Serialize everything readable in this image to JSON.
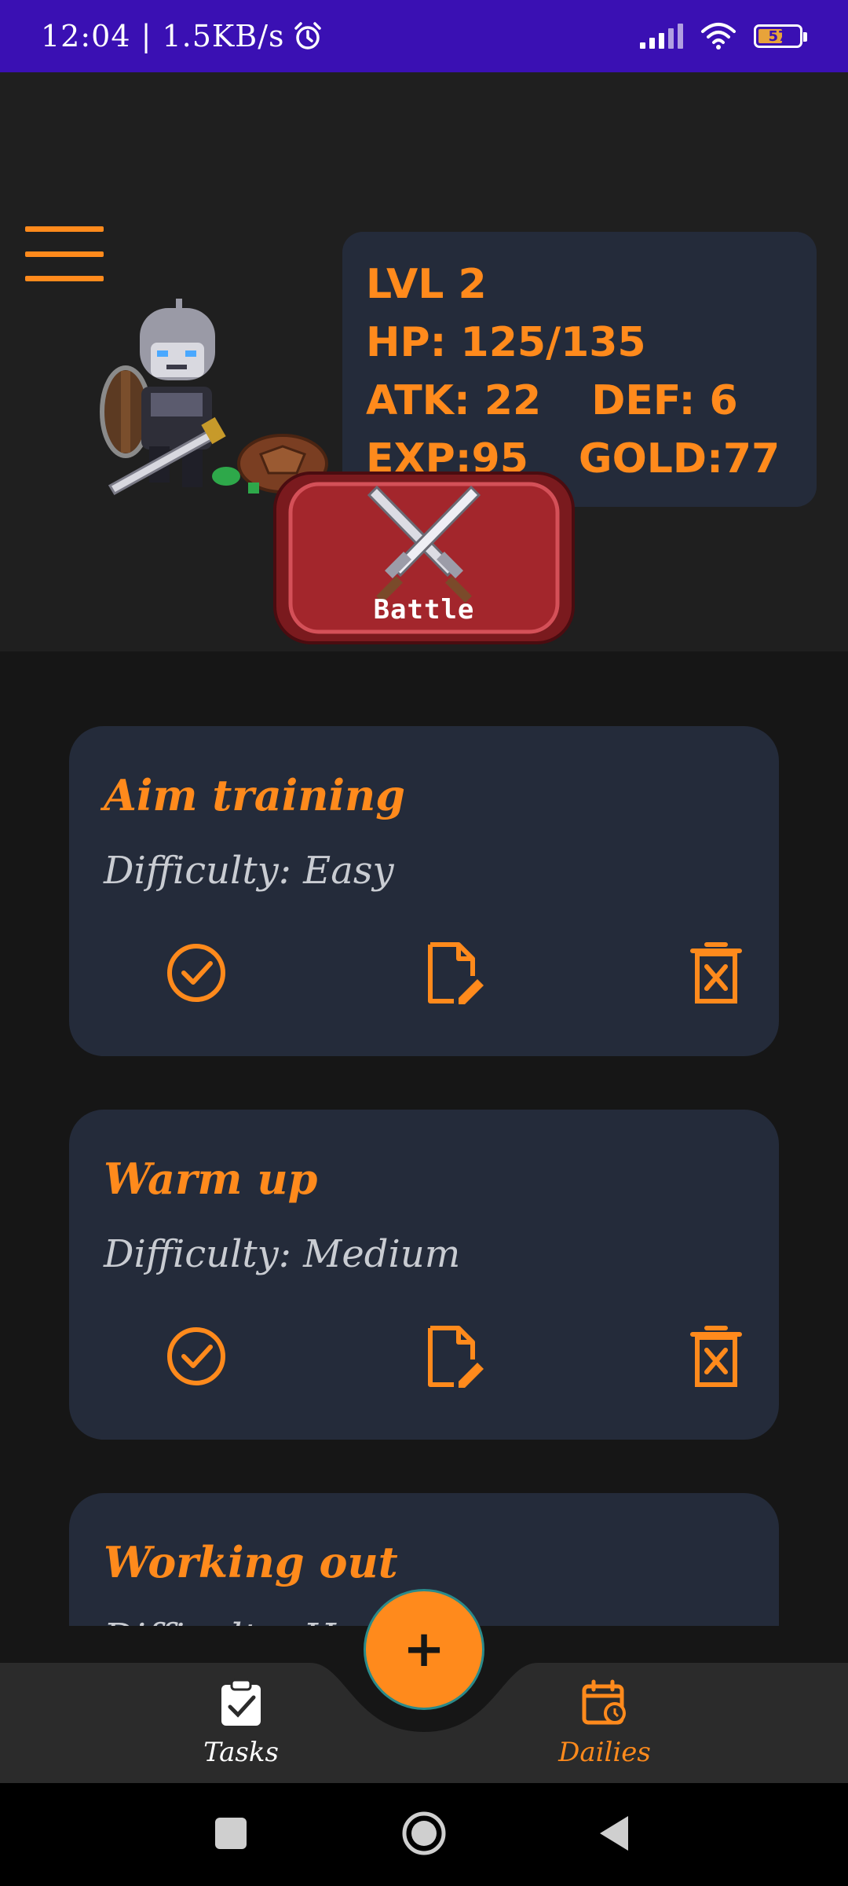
{
  "status_bar": {
    "time_speed": "12:04 | 1.5KB/s",
    "battery_level": "57",
    "icons": [
      "alarm-icon",
      "signal-icon",
      "wifi-icon",
      "battery-icon"
    ]
  },
  "player": {
    "level_line": "LVL 2",
    "hp_line": "HP: 125/135",
    "atk": "ATK: 22",
    "def": "DEF: 6",
    "exp": "EXP:95",
    "gold": "GOLD:77"
  },
  "battle": {
    "label": "Battle"
  },
  "tasks": [
    {
      "title": "Aim training",
      "difficulty": "Difficulty: Easy"
    },
    {
      "title": "Warm up",
      "difficulty": "Difficulty: Medium"
    },
    {
      "title": "Working out",
      "difficulty": "Difficulty: Hard"
    }
  ],
  "bottom_nav": {
    "tasks_label": "Tasks",
    "dailies_label": "Dailies",
    "fab_label": "+"
  },
  "colors": {
    "accent": "#ff8a1c",
    "card": "#242b3a",
    "status_bar": "#3a10b3",
    "background": "#161616"
  }
}
